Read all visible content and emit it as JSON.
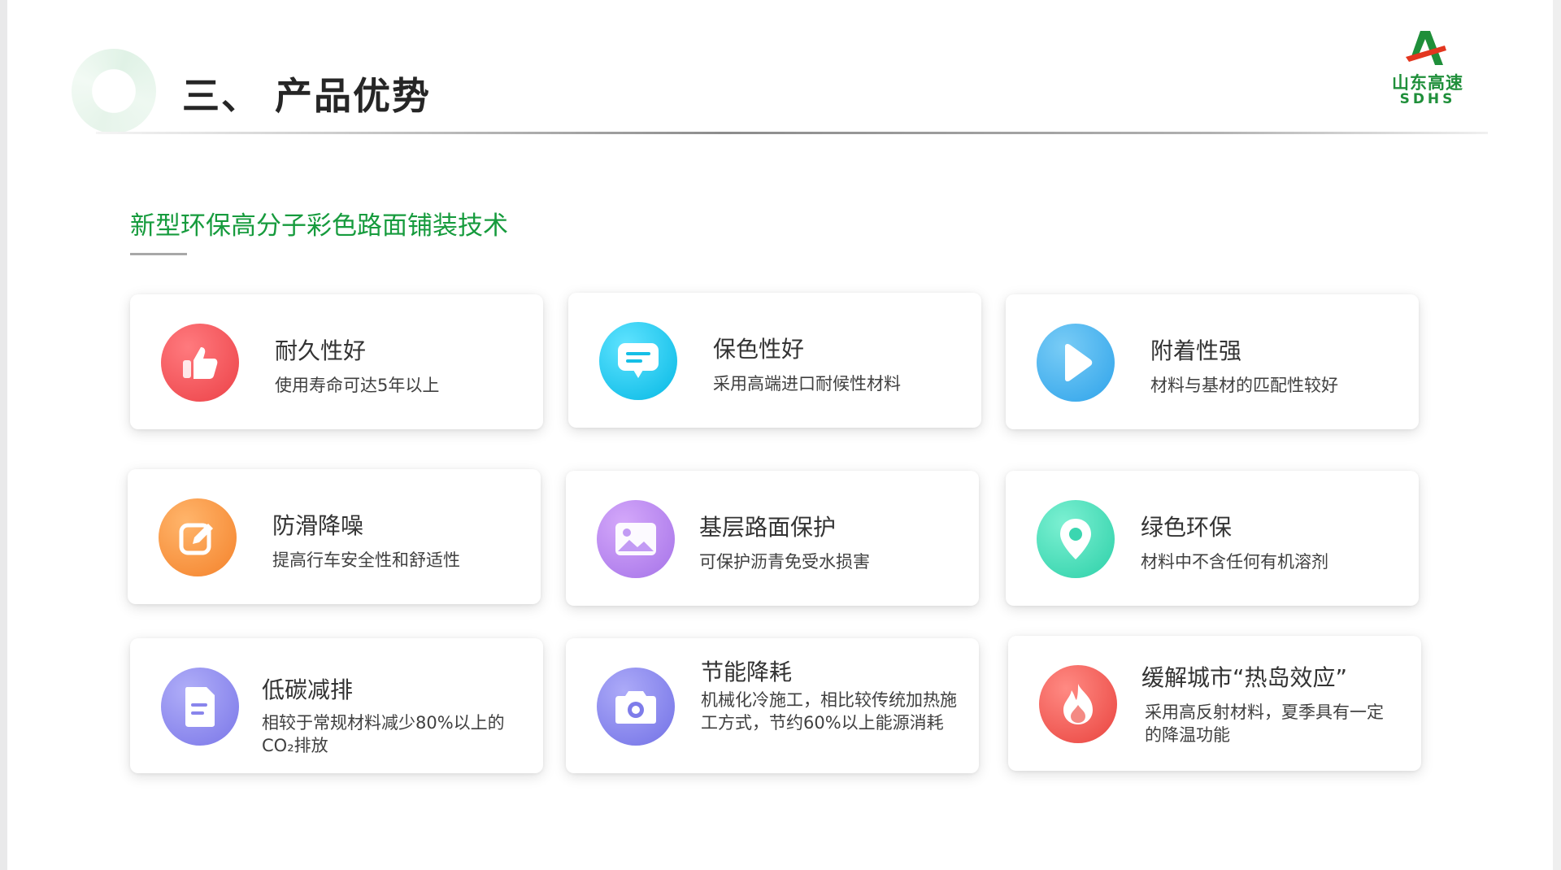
{
  "header": {
    "title": "三、 产品优势",
    "logo": {
      "cn": "山东高速",
      "en": "SDHS",
      "brand_green": "#1f8f3a",
      "brand_red": "#e3361f"
    }
  },
  "subtitle": "新型环保高分子彩色路面铺装技术",
  "cards": [
    {
      "title": "耐久性好",
      "desc": "使用寿命可达5年以上",
      "icon": "thumbs-up-icon",
      "color": "#f2545b"
    },
    {
      "title": "保色性好",
      "desc": "采用高端进口耐候性材料",
      "icon": "chat-bubble-icon",
      "color": "#11c6ea"
    },
    {
      "title": "附着性强",
      "desc": "材料与基材的匹配性较好",
      "icon": "play-icon",
      "color": "#3fb2ef"
    },
    {
      "title": "防滑降噪",
      "desc": "提高行车安全性和舒适性",
      "icon": "edit-icon",
      "color": "#f7963f"
    },
    {
      "title": "基层路面保护",
      "desc": "可保护沥青免受水损害",
      "icon": "image-icon",
      "color": "#b683ec"
    },
    {
      "title": "绿色环保",
      "desc": "材料中不含任何有机溶剂",
      "icon": "location-pin-icon",
      "color": "#3fd9b3"
    },
    {
      "title": "低碳减排",
      "desc": "相较于常规材料减少80%以上的CO₂排放",
      "icon": "document-icon",
      "color": "#8a86ee"
    },
    {
      "title": "节能降耗",
      "desc": "机械化冷施工，相比较传统加热施工方式，节约60%以上能源消耗",
      "icon": "camera-icon",
      "color": "#8383ec"
    },
    {
      "title": "缓解城市“热岛效应”",
      "desc": "采用高反射材料，夏季具有一定的降温功能",
      "icon": "flame-icon",
      "color": "#f0524e"
    }
  ]
}
